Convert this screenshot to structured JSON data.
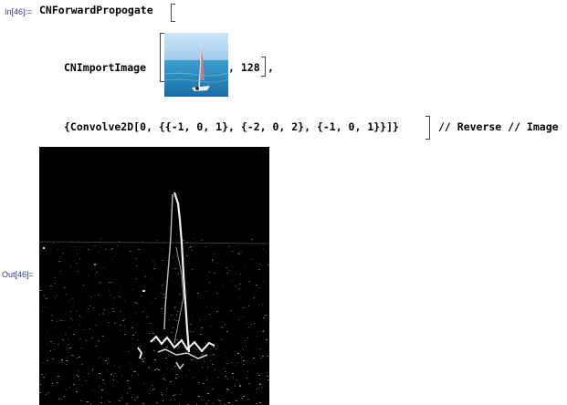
{
  "input_cell": {
    "label": "In[46]:=",
    "function_name": "CNForwardPropogate",
    "import_function": "CNImportImage",
    "import_arg": ", 128",
    "import_close": ",",
    "layer_list": "{Convolve2D[0, {{-1, 0, 1}, {-2, 0, 2}, {-1, 0, 1}}]}",
    "postfix": "// Reverse // Image",
    "thumbnail": {
      "description_icon": "sailboat-thumbnail",
      "sky_color": "#a9d4ee",
      "sea_color": "#2d8fc0"
    }
  },
  "output_cell": {
    "label": "Out[46]=",
    "image_icon": "edge-filtered-sailboat-image",
    "background_color": "#000000"
  }
}
